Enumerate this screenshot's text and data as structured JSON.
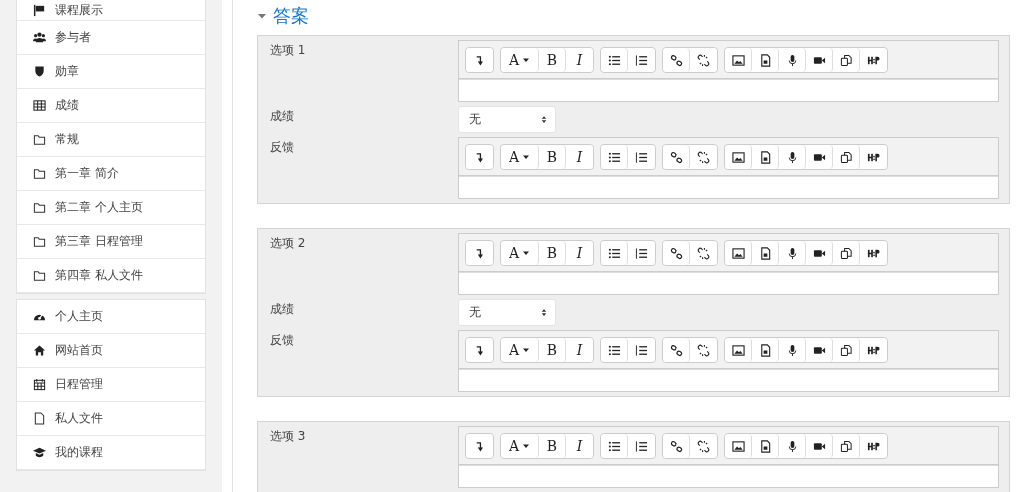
{
  "sidebar": {
    "groups": [
      {
        "items": [
          {
            "kind": "flag",
            "label": "课程展示"
          },
          {
            "kind": "users",
            "label": "参与者"
          },
          {
            "kind": "shield",
            "label": "勋章"
          },
          {
            "kind": "table",
            "label": "成绩"
          },
          {
            "kind": "folder",
            "label": "常规"
          },
          {
            "kind": "folder",
            "label": "第一章 简介"
          },
          {
            "kind": "folder",
            "label": "第二章 个人主页"
          },
          {
            "kind": "folder",
            "label": "第三章 日程管理"
          },
          {
            "kind": "folder",
            "label": "第四章 私人文件"
          }
        ]
      },
      {
        "items": [
          {
            "kind": "gauge",
            "label": "个人主页"
          },
          {
            "kind": "home",
            "label": "网站首页"
          },
          {
            "kind": "calendar",
            "label": "日程管理"
          },
          {
            "kind": "file",
            "label": "私人文件"
          },
          {
            "kind": "cap",
            "label": "我的课程"
          }
        ]
      }
    ]
  },
  "section": {
    "title": "答案",
    "expanded": true,
    "answers": [
      {
        "rows": [
          {
            "kind": "editor",
            "label": "选项 1",
            "toolbar": [
              [
                {
                  "kind": "collapse"
                }
              ],
              [
                {
                  "kind": "font",
                  "label": "A"
                },
                {
                  "kind": "bold",
                  "label": "B"
                },
                {
                  "kind": "italic",
                  "label": "I"
                }
              ],
              [
                {
                  "kind": "bullets"
                },
                {
                  "kind": "numbers"
                }
              ],
              [
                {
                  "kind": "link"
                },
                {
                  "kind": "unlink"
                }
              ],
              [
                {
                  "kind": "image"
                },
                {
                  "kind": "media"
                },
                {
                  "kind": "mic"
                },
                {
                  "kind": "video"
                },
                {
                  "kind": "copy"
                },
                {
                  "kind": "h5p"
                }
              ]
            ]
          },
          {
            "kind": "select",
            "label": "成绩",
            "value": "无"
          },
          {
            "kind": "editor",
            "label": "反馈",
            "toolbar": [
              [
                {
                  "kind": "collapse"
                }
              ],
              [
                {
                  "kind": "font",
                  "label": "A"
                },
                {
                  "kind": "bold",
                  "label": "B"
                },
                {
                  "kind": "italic",
                  "label": "I"
                }
              ],
              [
                {
                  "kind": "bullets"
                },
                {
                  "kind": "numbers"
                }
              ],
              [
                {
                  "kind": "link"
                },
                {
                  "kind": "unlink"
                }
              ],
              [
                {
                  "kind": "image"
                },
                {
                  "kind": "media"
                },
                {
                  "kind": "mic"
                },
                {
                  "kind": "video"
                },
                {
                  "kind": "copy"
                },
                {
                  "kind": "h5p"
                }
              ]
            ]
          }
        ]
      },
      {
        "rows": [
          {
            "kind": "editor",
            "label": "选项 2",
            "toolbar": [
              [
                {
                  "kind": "collapse"
                }
              ],
              [
                {
                  "kind": "font",
                  "label": "A"
                },
                {
                  "kind": "bold",
                  "label": "B"
                },
                {
                  "kind": "italic",
                  "label": "I"
                }
              ],
              [
                {
                  "kind": "bullets"
                },
                {
                  "kind": "numbers"
                }
              ],
              [
                {
                  "kind": "link"
                },
                {
                  "kind": "unlink"
                }
              ],
              [
                {
                  "kind": "image"
                },
                {
                  "kind": "media"
                },
                {
                  "kind": "mic"
                },
                {
                  "kind": "video"
                },
                {
                  "kind": "copy"
                },
                {
                  "kind": "h5p"
                }
              ]
            ]
          },
          {
            "kind": "select",
            "label": "成绩",
            "value": "无"
          },
          {
            "kind": "editor",
            "label": "反馈",
            "toolbar": [
              [
                {
                  "kind": "collapse"
                }
              ],
              [
                {
                  "kind": "font",
                  "label": "A"
                },
                {
                  "kind": "bold",
                  "label": "B"
                },
                {
                  "kind": "italic",
                  "label": "I"
                }
              ],
              [
                {
                  "kind": "bullets"
                },
                {
                  "kind": "numbers"
                }
              ],
              [
                {
                  "kind": "link"
                },
                {
                  "kind": "unlink"
                }
              ],
              [
                {
                  "kind": "image"
                },
                {
                  "kind": "media"
                },
                {
                  "kind": "mic"
                },
                {
                  "kind": "video"
                },
                {
                  "kind": "copy"
                },
                {
                  "kind": "h5p"
                }
              ]
            ]
          }
        ]
      },
      {
        "rows": [
          {
            "kind": "editor",
            "label": "选项 3",
            "toolbar": [
              [
                {
                  "kind": "collapse"
                }
              ],
              [
                {
                  "kind": "font",
                  "label": "A"
                },
                {
                  "kind": "bold",
                  "label": "B"
                },
                {
                  "kind": "italic",
                  "label": "I"
                }
              ],
              [
                {
                  "kind": "bullets"
                },
                {
                  "kind": "numbers"
                }
              ],
              [
                {
                  "kind": "link"
                },
                {
                  "kind": "unlink"
                }
              ],
              [
                {
                  "kind": "image"
                },
                {
                  "kind": "media"
                },
                {
                  "kind": "mic"
                },
                {
                  "kind": "video"
                },
                {
                  "kind": "copy"
                },
                {
                  "kind": "h5p"
                }
              ]
            ]
          }
        ]
      }
    ]
  }
}
